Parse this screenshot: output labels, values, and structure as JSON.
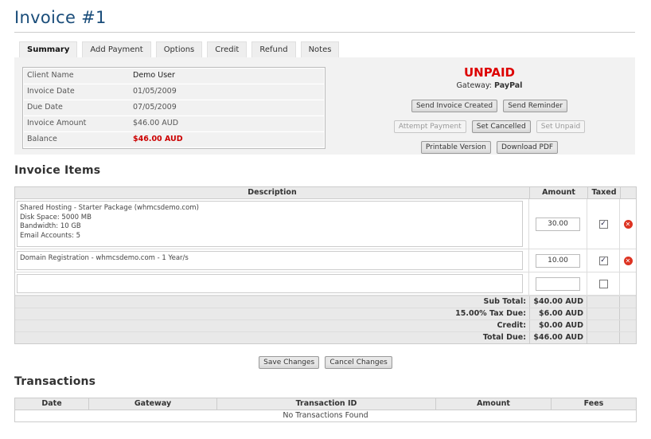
{
  "page": {
    "title": "Invoice #1"
  },
  "tabs": [
    "Summary",
    "Add Payment",
    "Options",
    "Credit",
    "Refund",
    "Notes"
  ],
  "summary": {
    "rows": [
      {
        "label": "Client Name",
        "value": "Demo User"
      },
      {
        "label": "Invoice Date",
        "value": "01/05/2009"
      },
      {
        "label": "Due Date",
        "value": "07/05/2009"
      },
      {
        "label": "Invoice Amount",
        "value": "$46.00 AUD"
      },
      {
        "label": "Balance",
        "value": "$46.00 AUD"
      }
    ],
    "status": "UNPAID",
    "gateway_label": "Gateway:",
    "gateway_value": "PayPal"
  },
  "actions": {
    "send_invoice_created": "Send Invoice Created",
    "send_reminder": "Send Reminder",
    "attempt_payment": "Attempt Payment",
    "set_cancelled": "Set Cancelled",
    "set_unpaid": "Set Unpaid",
    "printable_version": "Printable Version",
    "download_pdf": "Download PDF"
  },
  "items": {
    "section_title": "Invoice Items",
    "headers": {
      "description": "Description",
      "amount": "Amount",
      "taxed": "Taxed"
    },
    "rows": [
      {
        "description": "Shared Hosting - Starter Package (whmcsdemo.com)\nDisk Space: 5000 MB\nBandwidth: 10 GB\nEmail Accounts: 5",
        "amount": "30.00",
        "taxed": true
      },
      {
        "description": "Domain Registration - whmcsdemo.com - 1 Year/s",
        "amount": "10.00",
        "taxed": true
      },
      {
        "description": "",
        "amount": "",
        "taxed": false
      }
    ],
    "totals": [
      {
        "label": "Sub Total:",
        "value": "$40.00 AUD"
      },
      {
        "label": "15.00% Tax Due:",
        "value": "$6.00 AUD"
      },
      {
        "label": "Credit:",
        "value": "$0.00 AUD"
      },
      {
        "label": "Total Due:",
        "value": "$46.00 AUD"
      }
    ],
    "save_changes": "Save Changes",
    "cancel_changes": "Cancel Changes"
  },
  "transactions": {
    "section_title": "Transactions",
    "headers": [
      "Date",
      "Gateway",
      "Transaction ID",
      "Amount",
      "Fees"
    ],
    "empty": "No Transactions Found"
  },
  "colors": {
    "title": "#1a4d7a",
    "status_unpaid": "#dd0000",
    "balance": "#cc0000"
  }
}
